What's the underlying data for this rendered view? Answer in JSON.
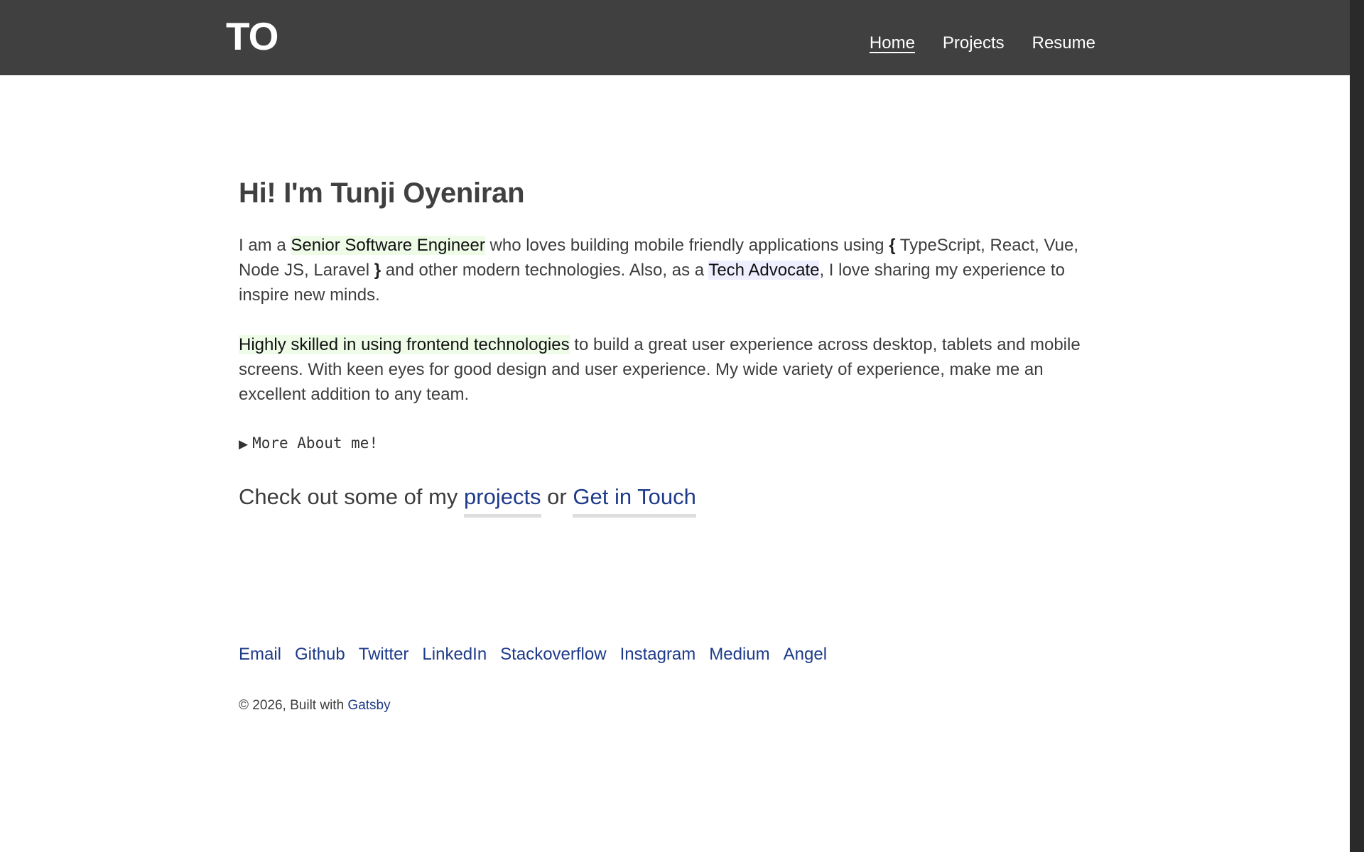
{
  "header": {
    "logo": "TO",
    "nav": [
      {
        "label": "Home",
        "active": true
      },
      {
        "label": "Projects",
        "active": false
      },
      {
        "label": "Resume",
        "active": false
      }
    ]
  },
  "main": {
    "title": "Hi! I'm Tunji Oyeniran",
    "para1": {
      "t1": "I am a ",
      "role": "Senior Software Engineer",
      "t2": " who loves building mobile friendly applications using ",
      "brace_open": "{",
      "stack": " TypeScript, React, Vue, Node JS, Laravel ",
      "brace_close": "}",
      "t3": " and other modern technologies. Also, as a ",
      "advocate": "Tech Advocate",
      "t4": ", I love sharing my experience to inspire new minds."
    },
    "para2": {
      "highlight": "Highly skilled in using frontend technologies",
      "rest": " to build a great user experience across desktop, tablets and mobile screens. With keen eyes for good design and user experience. My wide variety of experience, make me an excellent addition to any team."
    },
    "details": {
      "arrow": "▶",
      "summary": "More About me!"
    },
    "cta": {
      "prefix": "Check out some of my ",
      "projects_link": "projects",
      "middle": " or ",
      "contact_link": "Get in Touch"
    }
  },
  "socials": [
    "Email",
    "Github",
    "Twitter",
    "LinkedIn",
    "Stackoverflow",
    "Instagram",
    "Medium",
    "Angel"
  ],
  "footer": {
    "copyright": "© 2026, Built with ",
    "link": "Gatsby"
  },
  "colors": {
    "header_bg": "#404040",
    "link": "#1e3b8a",
    "highlight_green": "#edfbe7",
    "highlight_blue": "#eeeeff"
  }
}
